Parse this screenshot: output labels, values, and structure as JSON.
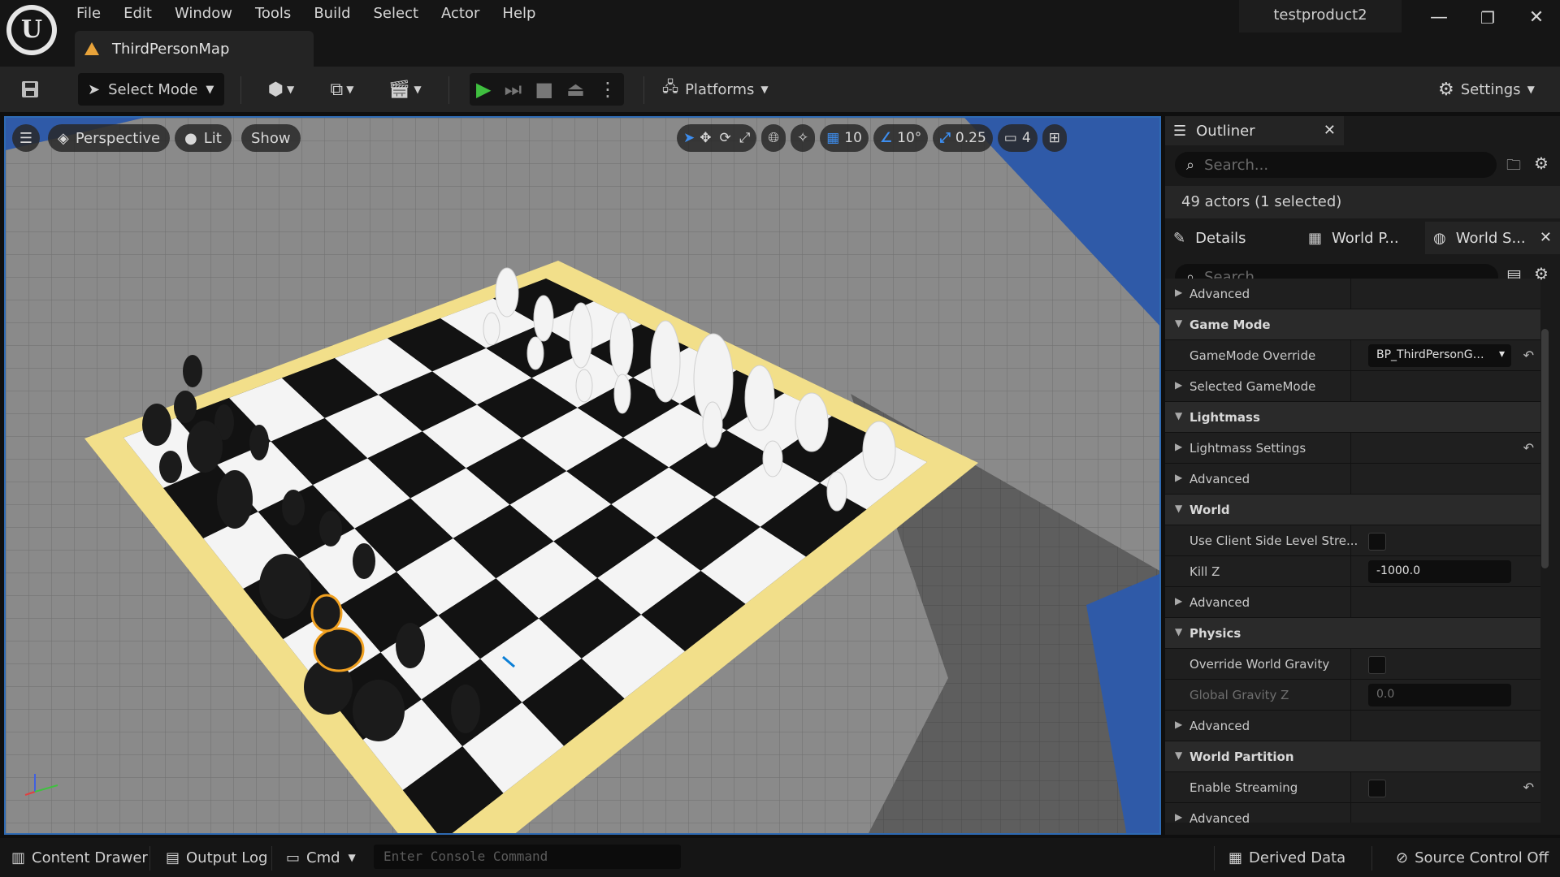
{
  "window": {
    "project_name": "testproduct2",
    "min_glyph": "—",
    "restore_glyph": "❐",
    "close_glyph": "✕",
    "map_tab_label": "ThirdPersonMap"
  },
  "menu": [
    "File",
    "Edit",
    "Window",
    "Tools",
    "Build",
    "Select",
    "Actor",
    "Help"
  ],
  "toolbar": {
    "select_mode_label": "Select Mode",
    "platforms_label": "Platforms",
    "settings_label": "Settings"
  },
  "viewport": {
    "perspective_label": "Perspective",
    "lit_label": "Lit",
    "show_label": "Show",
    "grid_snap": "10",
    "rotation_snap": "10°",
    "scale_snap": "0.25",
    "camera_speed": "4"
  },
  "outliner": {
    "tab_label": "Outliner",
    "search_placeholder": "Search...",
    "actor_count": "49 actors (1 selected)"
  },
  "details_tabs": {
    "details": "Details",
    "world_partition": "World P...",
    "world_settings": "World S..."
  },
  "details_search_placeholder": "Search",
  "properties": [
    {
      "type": "sub",
      "label": "Advanced"
    },
    {
      "type": "cat",
      "label": "Game Mode"
    },
    {
      "type": "field",
      "label": "GameMode Override",
      "value": "BP_ThirdPersonG…",
      "dropdown": true,
      "reset": true
    },
    {
      "type": "sub",
      "label": "Selected GameMode"
    },
    {
      "type": "cat",
      "label": "Lightmass"
    },
    {
      "type": "sub",
      "label": "Lightmass Settings",
      "reset": true
    },
    {
      "type": "sub",
      "label": "Advanced"
    },
    {
      "type": "cat",
      "label": "World"
    },
    {
      "type": "check",
      "label": "Use Client Side Level Stre...",
      "checked": false
    },
    {
      "type": "field",
      "label": "Kill Z",
      "value": "-1000.0"
    },
    {
      "type": "sub",
      "label": "Advanced"
    },
    {
      "type": "cat",
      "label": "Physics"
    },
    {
      "type": "check",
      "label": "Override World Gravity",
      "checked": false
    },
    {
      "type": "field",
      "label": "Global Gravity Z",
      "value": "0.0",
      "disabled": true
    },
    {
      "type": "sub",
      "label": "Advanced"
    },
    {
      "type": "cat",
      "label": "World Partition"
    },
    {
      "type": "check",
      "label": "Enable Streaming",
      "checked": false,
      "reset": true
    },
    {
      "type": "sub",
      "label": "Advanced"
    }
  ],
  "statusbar": {
    "content_drawer": "Content Drawer",
    "output_log": "Output Log",
    "cmd": "Cmd",
    "console_placeholder": "Enter Console Command",
    "derived_data": "Derived Data",
    "source_control": "Source Control Off"
  },
  "colors": {
    "accent_blue": "#3d8ef0",
    "board_frame": "#f2df8a",
    "selection_outline": "#f0a020"
  }
}
